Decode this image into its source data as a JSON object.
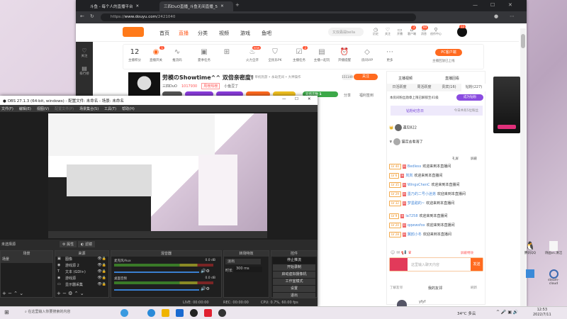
{
  "browser": {
    "tabs": [
      {
        "label": "斗鱼 - 每个人的直播平台"
      },
      {
        "label": "三四DuO直播_斗鱼无间直播_5"
      }
    ],
    "new_tab": "+",
    "url_prefix": "https://",
    "url_domain": "www.douyu.com",
    "url_path": "/2421040"
  },
  "douyu": {
    "nav": [
      "首页",
      "直播",
      "分类",
      "视频",
      "游戏",
      "鱼吧"
    ],
    "search_placeholder": "又双叒叕bella",
    "header_icons": [
      "历史",
      "关注",
      "开播",
      "客户端",
      "消息",
      "创作中心"
    ],
    "header_badges": {
      "client": "3",
      "message": "99",
      "avatar": "12"
    },
    "sidebar": [
      "关注",
      "排行榜"
    ],
    "score": "12",
    "score_label": "主播积分",
    "tools": [
      {
        "label": "直播开关",
        "badge": "1"
      },
      {
        "label": "推流码"
      },
      {
        "label": "夏季任务"
      },
      {
        "label": ""
      },
      {
        "label": "火力全开",
        "badge": "new"
      },
      {
        "label": "全民乐PK"
      },
      {
        "label": "主播任务",
        "badge": "2"
      },
      {
        "label": "主播一起玩"
      },
      {
        "label": "开播提醒"
      },
      {
        "label": "房间VIP"
      },
      {
        "label": "更多"
      }
    ],
    "pc_button": "PC客户端",
    "pc_sub": "主播回放已上线",
    "stream_title": "劳模のShowtime^^ 双倍亲密度!",
    "stream_tags": "举报  单机热游 • 永劫无间 • 大神操作",
    "streamer_name": "三四DuO",
    "hot": "1017930",
    "rank": "周榜热榜",
    "category": "小鱼豆丁",
    "fans_count": "151149",
    "follow": "关注",
    "share": "分享",
    "welfare": "福利签到",
    "double_label": "双倍次数",
    "double_count": "1"
  },
  "chat": {
    "top_links": [
      "主播视频",
      "直播回看"
    ],
    "tabs": [
      "日活跃度",
      "周活跃度",
      "贵宾(16)",
      "钻粉(227)"
    ],
    "notice": "本房间粉丝勋章上限已解锁至41级",
    "become_fan": "成为钻粉",
    "fan_day": "钻粉纪念日",
    "fan_day_sub": "今日共有5位粉丝",
    "vips": [
      {
        "name": "遇见822"
      },
      {
        "name": "猫定去看海了"
      }
    ],
    "checkbox_labels": [
      "礼屏",
      "屏蔽"
    ],
    "messages": [
      {
        "lv": "LV 40",
        "user": "Bedless",
        "text": "欢迎来到本直播间"
      },
      {
        "lv": "LV 6",
        "user": "岚岚",
        "text": "欢迎来到本直播间"
      },
      {
        "lv": "LV 35",
        "user": "WingsChenC",
        "text": "欢迎来到本直播间"
      },
      {
        "lv": "LV 29",
        "user": "墨乃的二号小迷弟",
        "text": "欢迎来到本直播间"
      },
      {
        "lv": "LV 32",
        "user": "梦墨甜的~",
        "text": "欢迎来到本直播间"
      },
      {
        "lv": "LV 9",
        "user": "la7258",
        "text": "欢迎来到本直播间"
      },
      {
        "lv": "LV 20",
        "user": "qqwwsfox",
        "text": "欢迎来到本直播间"
      },
      {
        "lv": "LV 28",
        "user": "翼鸥小冬",
        "text": "欢迎来到本直播间"
      }
    ],
    "block_effects": "屏蔽特效",
    "input_placeholder": "这里输入聊天内容",
    "send": "发送",
    "fans_bar": [
      "了解友邻",
      "我的友邻",
      "刷新"
    ],
    "friend_name": "yfyf"
  },
  "obs": {
    "title": "OBS 27.1.3 (64-bit, windows) - 配置文件: 未命名 - 场景: 未命名",
    "menu": [
      "文件(F)",
      "编辑(E)",
      "视图(V)",
      "配置文件(P)",
      "场景集合(S)",
      "工具(T)",
      "帮助(H)"
    ],
    "no_source": "未选择源",
    "props": "属性",
    "filters": "滤镜",
    "docks": {
      "scenes": "场景",
      "sources": "来源",
      "mixer": "混音器",
      "transitions": "转场特效",
      "controls": "控件"
    },
    "scene_items": [
      "场景"
    ],
    "source_items": [
      "图像",
      "游戏源 2",
      "文本 (GDI+)",
      "游戏源",
      "显示器采集"
    ],
    "mixer": [
      {
        "name": "麦克风/Aux",
        "db": "0.0 dB",
        "level": 0.7
      },
      {
        "name": "桌面音频",
        "db": "0.0 dB",
        "level": 0.81
      }
    ],
    "transition": "淡出",
    "duration_label": "时长",
    "duration": "300 ms",
    "controls": [
      "停止推流",
      "开始录制",
      "启动虚拟摄像机",
      "工作室模式",
      "设置",
      "退出"
    ],
    "status": {
      "live": "LIVE: 00:00:00",
      "rec": "REC: 00:00:00",
      "cpu": "CPU: 0.7%, 60.00 fps"
    }
  },
  "desktop": {
    "icons": [
      "腾讯QQ",
      "诗画vs.清洁",
      "",
      "steam-cloud"
    ]
  },
  "taskbar": {
    "search": "在这里输入你要搜索的内容",
    "weather": "34°C 多云",
    "time": "12:53",
    "date": "2022/7/11"
  }
}
